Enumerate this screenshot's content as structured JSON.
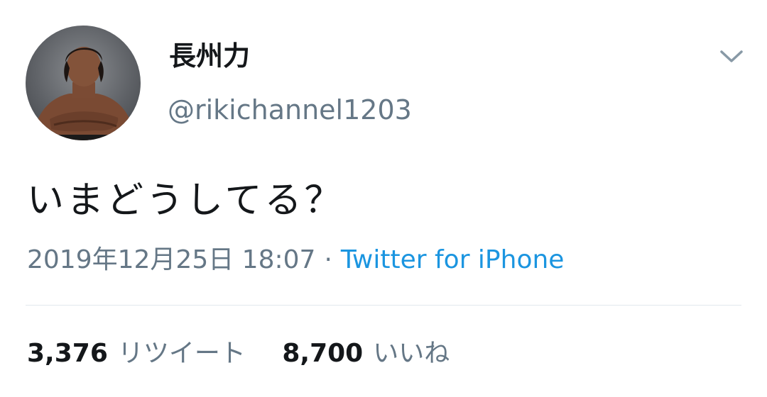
{
  "tweet": {
    "user": {
      "display_name": "長州力",
      "handle": "@rikichannel1203",
      "avatar_icon": "profile-photo"
    },
    "menu_icon": "chevron-down-icon",
    "text": "いまどうしてる？",
    "timestamp": "2019年12月25日 18:07",
    "separator": "·",
    "source": "Twitter for iPhone",
    "stats": {
      "retweets_count": "3,376",
      "retweets_label": "リツイート",
      "likes_count": "8,700",
      "likes_label": "いいね"
    }
  },
  "colors": {
    "text_primary": "#14171a",
    "text_secondary": "#657786",
    "link": "#1b95e0",
    "divider": "#e1e8ed"
  }
}
